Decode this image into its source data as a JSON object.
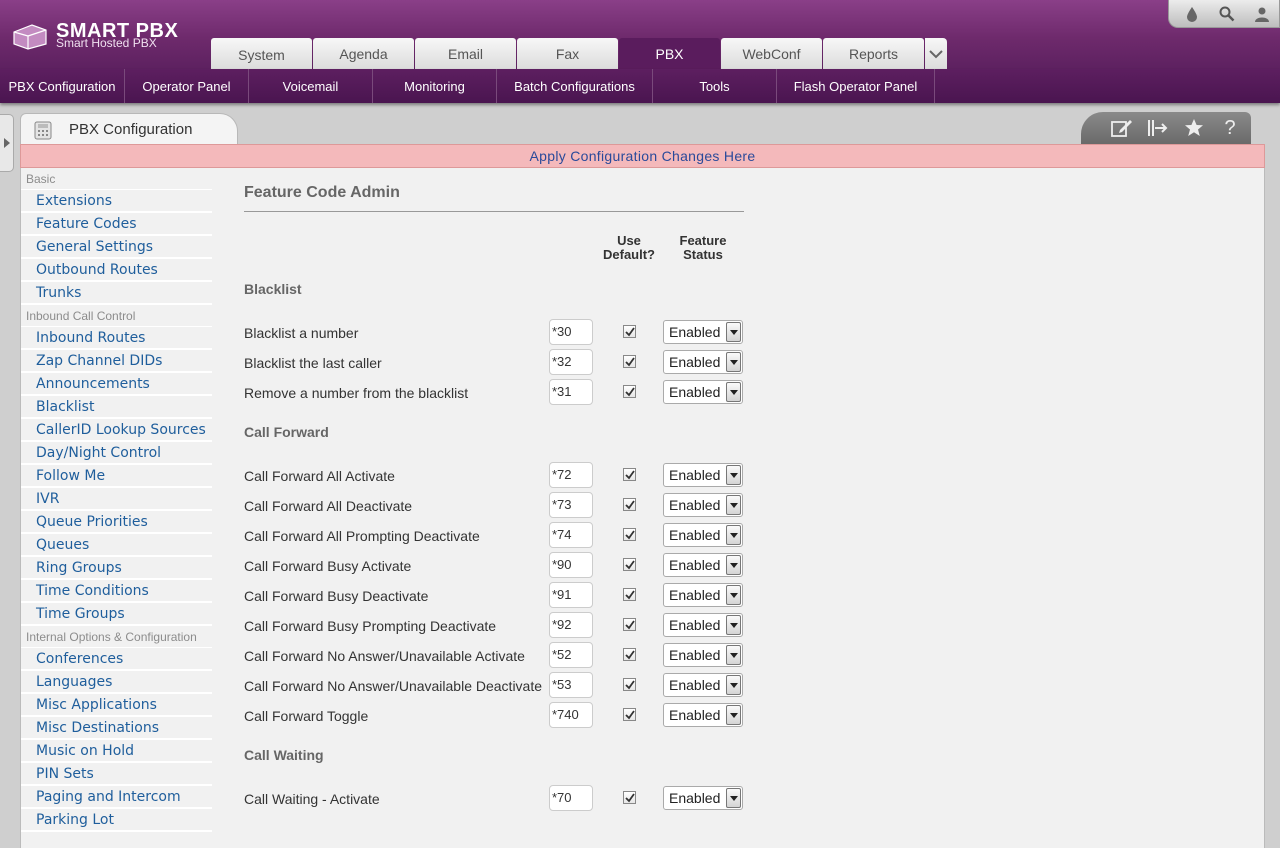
{
  "brand": {
    "name": "SMART PBX",
    "tagline": "Smart Hosted PBX"
  },
  "top_tools": [
    "drop-icon",
    "search-icon",
    "user-icon"
  ],
  "tabs": [
    {
      "label": "System",
      "active": false
    },
    {
      "label": "Agenda",
      "active": false
    },
    {
      "label": "Email",
      "active": false
    },
    {
      "label": "Fax",
      "active": false
    },
    {
      "label": "PBX",
      "active": true
    },
    {
      "label": "WebConf",
      "active": false
    },
    {
      "label": "Reports",
      "active": false
    }
  ],
  "submenu": [
    "PBX Configuration",
    "Operator Panel",
    "Voicemail",
    "Monitoring",
    "Batch Configurations",
    "Tools",
    "Flash Operator Panel"
  ],
  "panel": {
    "title": "PBX Configuration",
    "actions": [
      "edit-icon",
      "export-icon",
      "star-icon",
      "help-icon"
    ],
    "apply_text": "Apply Configuration Changes Here"
  },
  "sidebar": {
    "basic_title": "Basic",
    "basic": [
      "Extensions",
      "Feature Codes",
      "General Settings",
      "Outbound Routes",
      "Trunks"
    ],
    "inbound_title": "Inbound Call Control",
    "inbound": [
      "Inbound Routes",
      "Zap Channel DIDs",
      "Announcements",
      "Blacklist",
      "CallerID Lookup Sources",
      "Day/Night Control",
      "Follow Me",
      "IVR",
      "Queue Priorities",
      "Queues",
      "Ring Groups",
      "Time Conditions",
      "Time Groups"
    ],
    "internal_title": "Internal Options & Configuration",
    "internal": [
      "Conferences",
      "Languages",
      "Misc Applications",
      "Misc Destinations",
      "Music on Hold",
      "PIN Sets",
      "Paging and Intercom",
      "Parking Lot"
    ]
  },
  "form": {
    "title": "Feature Code Admin",
    "col_default": [
      "Use",
      "Default?"
    ],
    "col_status": [
      "Feature",
      "Status"
    ],
    "groups": [
      {
        "title": "Blacklist",
        "rows": [
          {
            "label": "Blacklist a number",
            "code": "*30",
            "default": true,
            "status": "Enabled"
          },
          {
            "label": "Blacklist the last caller",
            "code": "*32",
            "default": true,
            "status": "Enabled"
          },
          {
            "label": "Remove a number from the blacklist",
            "code": "*31",
            "default": true,
            "status": "Enabled"
          }
        ]
      },
      {
        "title": "Call Forward",
        "rows": [
          {
            "label": "Call Forward All Activate",
            "code": "*72",
            "default": true,
            "status": "Enabled"
          },
          {
            "label": "Call Forward All Deactivate",
            "code": "*73",
            "default": true,
            "status": "Enabled"
          },
          {
            "label": "Call Forward All Prompting Deactivate",
            "code": "*74",
            "default": true,
            "status": "Enabled"
          },
          {
            "label": "Call Forward Busy Activate",
            "code": "*90",
            "default": true,
            "status": "Enabled"
          },
          {
            "label": "Call Forward Busy Deactivate",
            "code": "*91",
            "default": true,
            "status": "Enabled"
          },
          {
            "label": "Call Forward Busy Prompting Deactivate",
            "code": "*92",
            "default": true,
            "status": "Enabled"
          },
          {
            "label": "Call Forward No Answer/Unavailable Activate",
            "code": "*52",
            "default": true,
            "status": "Enabled"
          },
          {
            "label": "Call Forward No Answer/Unavailable Deactivate",
            "code": "*53",
            "default": true,
            "status": "Enabled"
          },
          {
            "label": "Call Forward Toggle",
            "code": "*740",
            "default": true,
            "status": "Enabled"
          }
        ]
      },
      {
        "title": "Call Waiting",
        "rows": [
          {
            "label": "Call Waiting - Activate",
            "code": "*70",
            "default": true,
            "status": "Enabled"
          }
        ]
      }
    ]
  }
}
